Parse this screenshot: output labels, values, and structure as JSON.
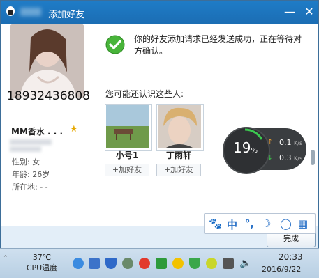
{
  "window": {
    "title": "添加好友",
    "minimize_label": "—",
    "close_label": "✕"
  },
  "profile": {
    "phone_overlay": "18932436808",
    "nickname": "MM香水 . . .",
    "gender_label": "性别: 女",
    "age_label": "年龄: 26岁",
    "location_label": "所在地: -    -"
  },
  "main": {
    "success_message": "你的好友添加请求已经发送成功，正在等待对方确认。",
    "suggest_title": "您可能还认识这些人:",
    "suggestions": [
      {
        "name": "小号1",
        "add_label": "+加好友"
      },
      {
        "name": "丁雨轩",
        "add_label": "+加好友"
      }
    ],
    "done_label": "完成"
  },
  "net_widget": {
    "cpu_percent": "19",
    "percent_sign": "%",
    "upload": "0.1",
    "download": "0.3",
    "unit": "K/s"
  },
  "ime_toolbar": {
    "chinese_mode": "中",
    "punct_mode": "°,",
    "moon": "☽"
  },
  "taskbar": {
    "cpu_temp": "37℃",
    "cpu_label": "CPU温度",
    "time": "20:33",
    "date": "2016/9/22"
  }
}
